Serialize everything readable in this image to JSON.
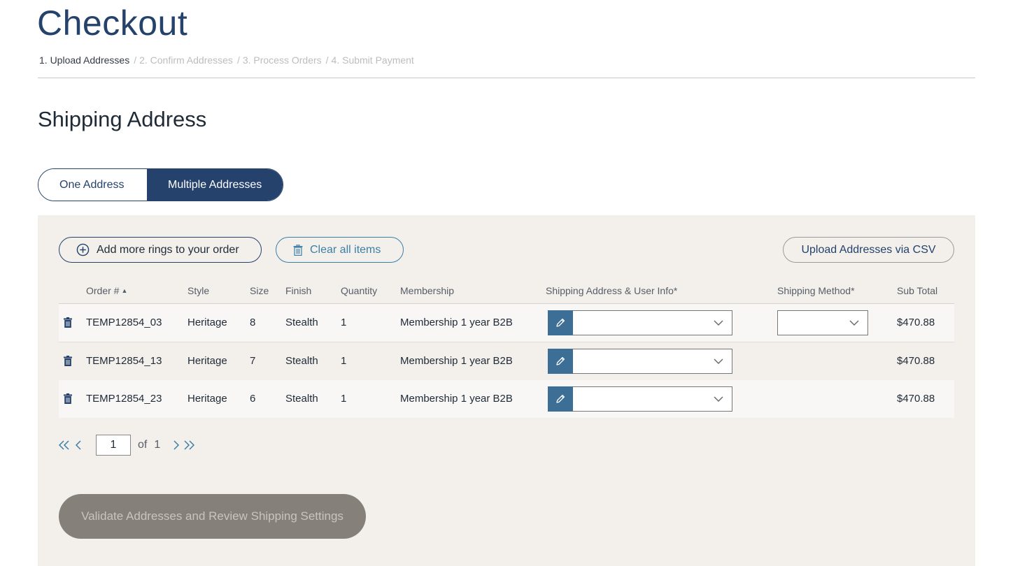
{
  "header": {
    "title": "Checkout",
    "breadcrumb": [
      {
        "label": "1. Upload Addresses"
      },
      {
        "label": "2. Confirm Addresses"
      },
      {
        "label": "3. Process Orders"
      },
      {
        "label": "4. Submit Payment"
      }
    ],
    "separator": "/"
  },
  "section_title": "Shipping Address",
  "toggle": {
    "one_label": "One Address",
    "multiple_label": "Multiple Addresses",
    "selected": "Multiple Addresses"
  },
  "actions": {
    "add_label": "Add more rings to your order",
    "clear_label": "Clear all items",
    "upload_label": "Upload Addresses via CSV"
  },
  "table": {
    "columns": {
      "order": "Order #",
      "style": "Style",
      "size": "Size",
      "finish": "Finish",
      "quantity": "Quantity",
      "membership": "Membership",
      "address": "Shipping Address & User Info*",
      "method": "Shipping Method*",
      "subtotal": "Sub Total"
    },
    "sort": {
      "column": "Order #",
      "direction": "ascending"
    },
    "rows": [
      {
        "order": "TEMP12854_03",
        "style": "Heritage",
        "size": "8",
        "finish": "Stealth",
        "quantity": "1",
        "membership": "Membership 1 year B2B",
        "address": "",
        "method": "",
        "subtotal": "$470.88"
      },
      {
        "order": "TEMP12854_13",
        "style": "Heritage",
        "size": "7",
        "finish": "Stealth",
        "quantity": "1",
        "membership": "Membership 1 year B2B",
        "address": "",
        "subtotal": "$470.88"
      },
      {
        "order": "TEMP12854_23",
        "style": "Heritage",
        "size": "6",
        "finish": "Stealth",
        "quantity": "1",
        "membership": "Membership 1 year B2B",
        "address": "",
        "subtotal": "$470.88"
      }
    ]
  },
  "pager": {
    "current_page": "1",
    "of_label": "of",
    "total_pages": "1"
  },
  "validate_label": "Validate Addresses and Review Shipping Settings",
  "colors": {
    "primary": "#24426b",
    "accent": "#3d7ea6",
    "edit_button": "#3d6f96",
    "panel_bg": "#f3f0ec",
    "disabled_button": "#858079"
  },
  "icons": [
    "plus-circle-icon",
    "trash-icon",
    "pencil-icon",
    "chevron-down-icon",
    "first-page-icon",
    "prev-page-icon",
    "next-page-icon",
    "last-page-icon",
    "sort-ascending-icon"
  ]
}
